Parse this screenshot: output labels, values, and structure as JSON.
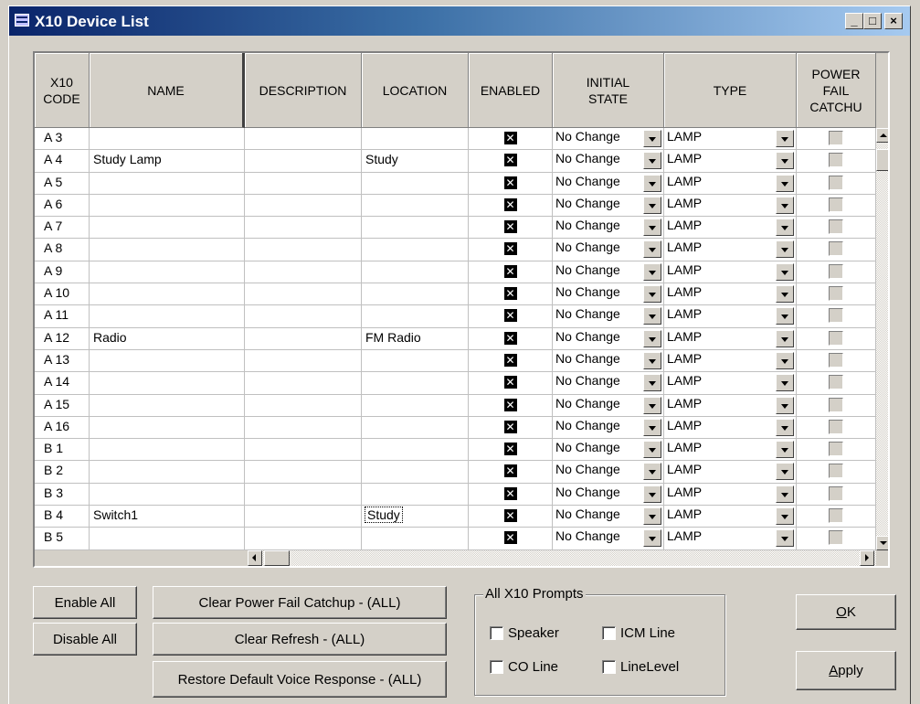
{
  "window": {
    "title": "X10 Device List",
    "controls": {
      "minimize": "_",
      "maximize": "□",
      "close": "×"
    }
  },
  "grid": {
    "columns": [
      {
        "key": "code",
        "label": "X10\nCODE"
      },
      {
        "key": "name",
        "label": "NAME"
      },
      {
        "key": "description",
        "label": "DESCRIPTION"
      },
      {
        "key": "location",
        "label": "LOCATION"
      },
      {
        "key": "enabled",
        "label": "ENABLED"
      },
      {
        "key": "initial_state",
        "label": "INITIAL\nSTATE"
      },
      {
        "key": "type",
        "label": "TYPE"
      },
      {
        "key": "power_fail",
        "label": "POWER\nFAIL\nCATCHU"
      }
    ],
    "rows": [
      {
        "code": "A  3",
        "name": "",
        "description": "",
        "location": "",
        "enabled": true,
        "initial_state": "No Change",
        "type": "LAMP",
        "power_fail": false
      },
      {
        "code": "A  4",
        "name": "Study Lamp",
        "description": "",
        "location": "Study",
        "enabled": true,
        "initial_state": "No Change",
        "type": "LAMP",
        "power_fail": false
      },
      {
        "code": "A  5",
        "name": "",
        "description": "",
        "location": "",
        "enabled": true,
        "initial_state": "No Change",
        "type": "LAMP",
        "power_fail": false
      },
      {
        "code": "A  6",
        "name": "",
        "description": "",
        "location": "",
        "enabled": true,
        "initial_state": "No Change",
        "type": "LAMP",
        "power_fail": false
      },
      {
        "code": "A  7",
        "name": "",
        "description": "",
        "location": "",
        "enabled": true,
        "initial_state": "No Change",
        "type": "LAMP",
        "power_fail": false
      },
      {
        "code": "A  8",
        "name": "",
        "description": "",
        "location": "",
        "enabled": true,
        "initial_state": "No Change",
        "type": "LAMP",
        "power_fail": false
      },
      {
        "code": "A  9",
        "name": "",
        "description": "",
        "location": "",
        "enabled": true,
        "initial_state": "No Change",
        "type": "LAMP",
        "power_fail": false
      },
      {
        "code": "A 10",
        "name": "",
        "description": "",
        "location": "",
        "enabled": true,
        "initial_state": "No Change",
        "type": "LAMP",
        "power_fail": false
      },
      {
        "code": "A 11",
        "name": "",
        "description": "",
        "location": "",
        "enabled": true,
        "initial_state": "No Change",
        "type": "LAMP",
        "power_fail": false
      },
      {
        "code": "A 12",
        "name": "Radio",
        "description": "",
        "location": "FM Radio",
        "enabled": true,
        "initial_state": "No Change",
        "type": "LAMP",
        "power_fail": false
      },
      {
        "code": "A 13",
        "name": "",
        "description": "",
        "location": "",
        "enabled": true,
        "initial_state": "No Change",
        "type": "LAMP",
        "power_fail": false
      },
      {
        "code": "A 14",
        "name": "",
        "description": "",
        "location": "",
        "enabled": true,
        "initial_state": "No Change",
        "type": "LAMP",
        "power_fail": false
      },
      {
        "code": "A 15",
        "name": "",
        "description": "",
        "location": "",
        "enabled": true,
        "initial_state": "No Change",
        "type": "LAMP",
        "power_fail": false
      },
      {
        "code": "A 16",
        "name": "",
        "description": "",
        "location": "",
        "enabled": true,
        "initial_state": "No Change",
        "type": "LAMP",
        "power_fail": false
      },
      {
        "code": "B  1",
        "name": "",
        "description": "",
        "location": "",
        "enabled": true,
        "initial_state": "No Change",
        "type": "LAMP",
        "power_fail": false
      },
      {
        "code": "B  2",
        "name": "",
        "description": "",
        "location": "",
        "enabled": true,
        "initial_state": "No Change",
        "type": "LAMP",
        "power_fail": false
      },
      {
        "code": "B  3",
        "name": "",
        "description": "",
        "location": "",
        "enabled": true,
        "initial_state": "No Change",
        "type": "LAMP",
        "power_fail": false
      },
      {
        "code": "B  4",
        "name": "Switch1",
        "description": "",
        "location": "Study",
        "enabled": true,
        "initial_state": "No Change",
        "type": "LAMP",
        "power_fail": false,
        "focused_location": true
      },
      {
        "code": "B  5",
        "name": "",
        "description": "",
        "location": "",
        "enabled": true,
        "initial_state": "No Change",
        "type": "LAMP",
        "power_fail": false
      }
    ]
  },
  "buttons": {
    "enable_all": "Enable All",
    "disable_all": "Disable All",
    "clear_power_fail": "Clear Power Fail Catchup - (ALL)",
    "clear_refresh": "Clear Refresh - (ALL)",
    "restore_voice": "Restore Default Voice Response - (ALL)",
    "ok_hotkey": "O",
    "ok_rest": "K",
    "apply_hotkey": "A",
    "apply_rest": "pply"
  },
  "prompts": {
    "title": "All X10 Prompts",
    "speaker": {
      "label": "Speaker",
      "checked": false
    },
    "icm_line": {
      "label": "ICM Line",
      "checked": false
    },
    "co_line": {
      "label": "CO Line",
      "checked": false
    },
    "line_level": {
      "label": "LineLevel",
      "checked": false
    }
  }
}
